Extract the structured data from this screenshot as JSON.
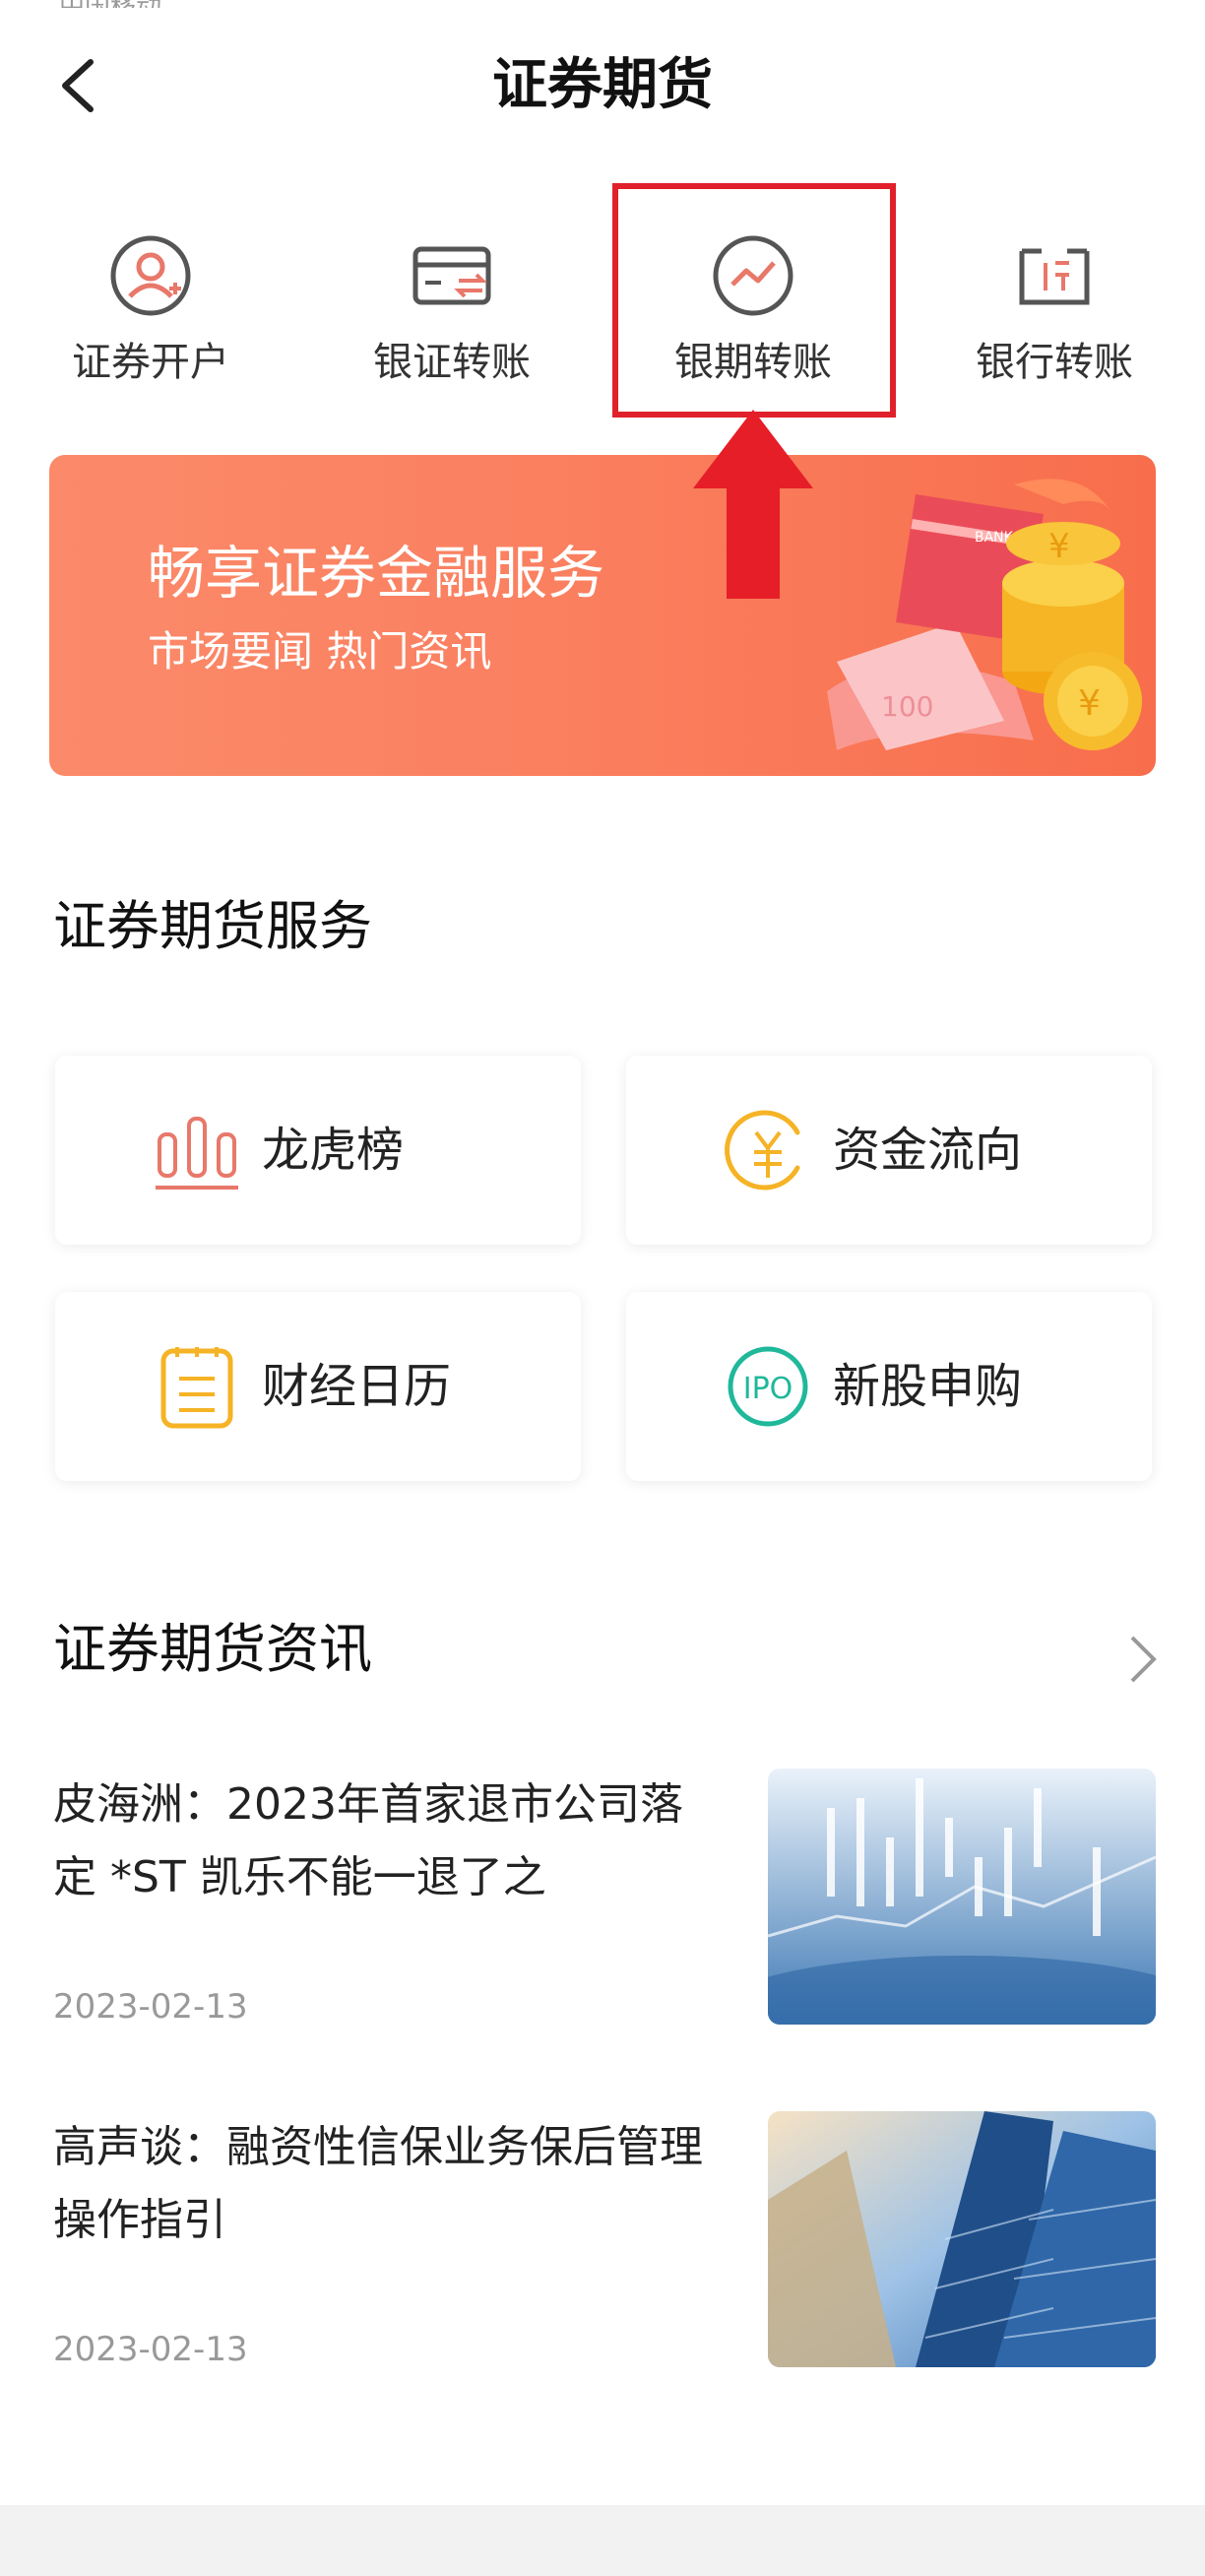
{
  "status_residue": "中国移动",
  "header": {
    "title": "证券期货"
  },
  "quick_actions": [
    {
      "label": "证券开户",
      "icon": "user-add-icon"
    },
    {
      "label": "银证转账",
      "icon": "card-transfer-icon"
    },
    {
      "label": "银期转账",
      "icon": "trend-circle-icon"
    },
    {
      "label": "银行转账",
      "icon": "bank-building-icon"
    }
  ],
  "banner": {
    "title": "畅享证券金融服务",
    "subtitle": "市场要闻 热门资讯",
    "card_text": "BANK",
    "note_text": "100",
    "coin_symbol": "¥"
  },
  "services_section": {
    "title": "证券期货服务",
    "items": [
      {
        "label": "龙虎榜",
        "icon": "bar-chart-icon",
        "color": "#e8786a"
      },
      {
        "label": "资金流向",
        "icon": "yuan-circle-icon",
        "color": "#f5b325"
      },
      {
        "label": "财经日历",
        "icon": "calendar-note-icon",
        "color": "#f5b325"
      },
      {
        "label": "新股申购",
        "icon": "ipo-circle-icon",
        "color": "#1fb89a",
        "icon_text": "IPO"
      }
    ]
  },
  "news_section": {
    "title": "证券期货资讯",
    "items": [
      {
        "title": "皮海洲：2023年首家退市公司落定 *ST 凯乐不能一退了之",
        "date": "2023-02-13",
        "image": "stock-chart-photo"
      },
      {
        "title": "高声谈：融资性信保业务保后管理操作指引",
        "date": "2023-02-13",
        "image": "skyscraper-photo"
      }
    ]
  },
  "colors": {
    "accent": "#e0202a",
    "banner": "#fa8060",
    "icon_gray": "#555555",
    "icon_red": "#e8786a"
  }
}
